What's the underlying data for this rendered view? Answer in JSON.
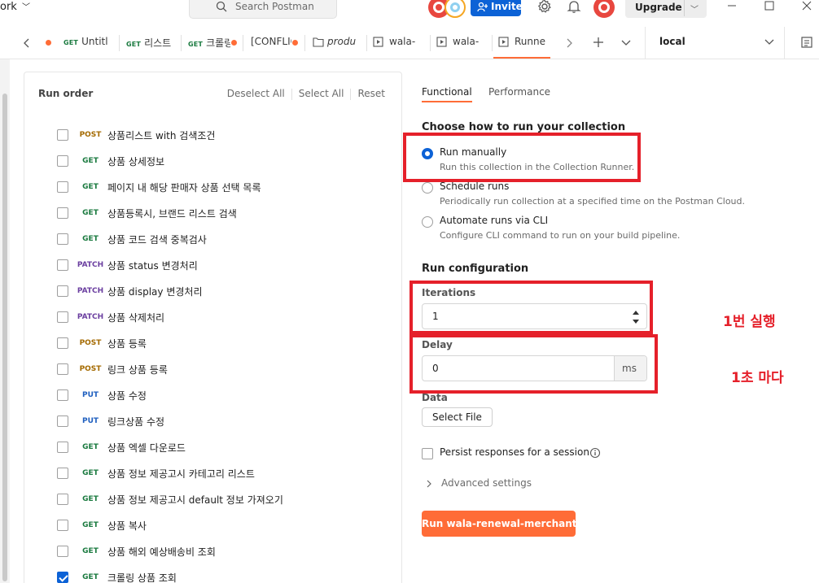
{
  "titlebar": {
    "workspace_label": "ork",
    "search_placeholder": "Search Postman",
    "invite_label": "Invite",
    "upgrade_label": "Upgrade"
  },
  "tabs": [
    {
      "method": "GET",
      "label": "Untitl",
      "unsaved": true
    },
    {
      "method": "GET",
      "label": "리스트",
      "unsaved": false
    },
    {
      "method": "GET",
      "label": "크롤링",
      "unsaved": true
    },
    {
      "method": "",
      "label": "[CONFLIC",
      "unsaved": true
    },
    {
      "method": "",
      "label": "produ",
      "unsaved": false
    },
    {
      "method": "",
      "label": "wala-",
      "unsaved": false
    },
    {
      "method": "",
      "label": "wala-",
      "unsaved": false
    },
    {
      "method": "",
      "label": "Runne",
      "unsaved": false
    }
  ],
  "environment": {
    "selected": "local"
  },
  "run_order": {
    "title": "Run order",
    "deselect_all": "Deselect All",
    "select_all": "Select All",
    "reset": "Reset",
    "requests": [
      {
        "method": "POST",
        "name": "상품리스트 with 검색조건",
        "checked": false
      },
      {
        "method": "GET",
        "name": "상품 상세정보",
        "checked": false
      },
      {
        "method": "GET",
        "name": "페이지 내 해당 판매자 상품 선택 목록",
        "checked": false
      },
      {
        "method": "GET",
        "name": "상품등록시, 브랜드 리스트 검색",
        "checked": false
      },
      {
        "method": "GET",
        "name": "상품 코드 검색 중복검사",
        "checked": false
      },
      {
        "method": "PATCH",
        "name": "상품 status 변경처리",
        "checked": false
      },
      {
        "method": "PATCH",
        "name": "상품 display 변경처리",
        "checked": false
      },
      {
        "method": "PATCH",
        "name": "상품 삭제처리",
        "checked": false
      },
      {
        "method": "POST",
        "name": "상품 등록",
        "checked": false
      },
      {
        "method": "POST",
        "name": "링크 상품 등록",
        "checked": false
      },
      {
        "method": "PUT",
        "name": "상품 수정",
        "checked": false
      },
      {
        "method": "PUT",
        "name": "링크상품 수정",
        "checked": false
      },
      {
        "method": "GET",
        "name": "상품 엑셀 다운로드",
        "checked": false
      },
      {
        "method": "GET",
        "name": "상품 정보 제공고시 카테고리 리스트",
        "checked": false
      },
      {
        "method": "GET",
        "name": "상품 정보 제공고시 default 정보 가져오기",
        "checked": false
      },
      {
        "method": "GET",
        "name": "상품 복사",
        "checked": false
      },
      {
        "method": "GET",
        "name": "상품 해외 예상배송비 조회",
        "checked": false
      },
      {
        "method": "GET",
        "name": "크롤링 상품 조회",
        "checked": true
      }
    ]
  },
  "runner": {
    "tabs": {
      "functional": "Functional",
      "performance": "Performance"
    },
    "choose_title": "Choose how to run your collection",
    "options": [
      {
        "label": "Run manually",
        "desc": "Run this collection in the Collection Runner.",
        "selected": true
      },
      {
        "label": "Schedule runs",
        "desc": "Periodically run collection at a specified time on the Postman Cloud.",
        "selected": false
      },
      {
        "label": "Automate runs via CLI",
        "desc": "Configure CLI command to run on your build pipeline.",
        "selected": false
      }
    ],
    "config_title": "Run configuration",
    "iterations_label": "Iterations",
    "iterations_value": "1",
    "delay_label": "Delay",
    "delay_value": "0",
    "delay_unit": "ms",
    "data_label": "Data",
    "select_file": "Select File",
    "persist_label": "Persist responses for a session",
    "advanced_label": "Advanced settings",
    "run_button": "Run wala-renewal-merchant"
  },
  "annotations": {
    "iterations_note": "1번 실행",
    "delay_note": "1초 마다",
    "color": "#e5202a"
  },
  "colors": {
    "accent": "#ff6c37",
    "primary": "#0c62d6"
  }
}
